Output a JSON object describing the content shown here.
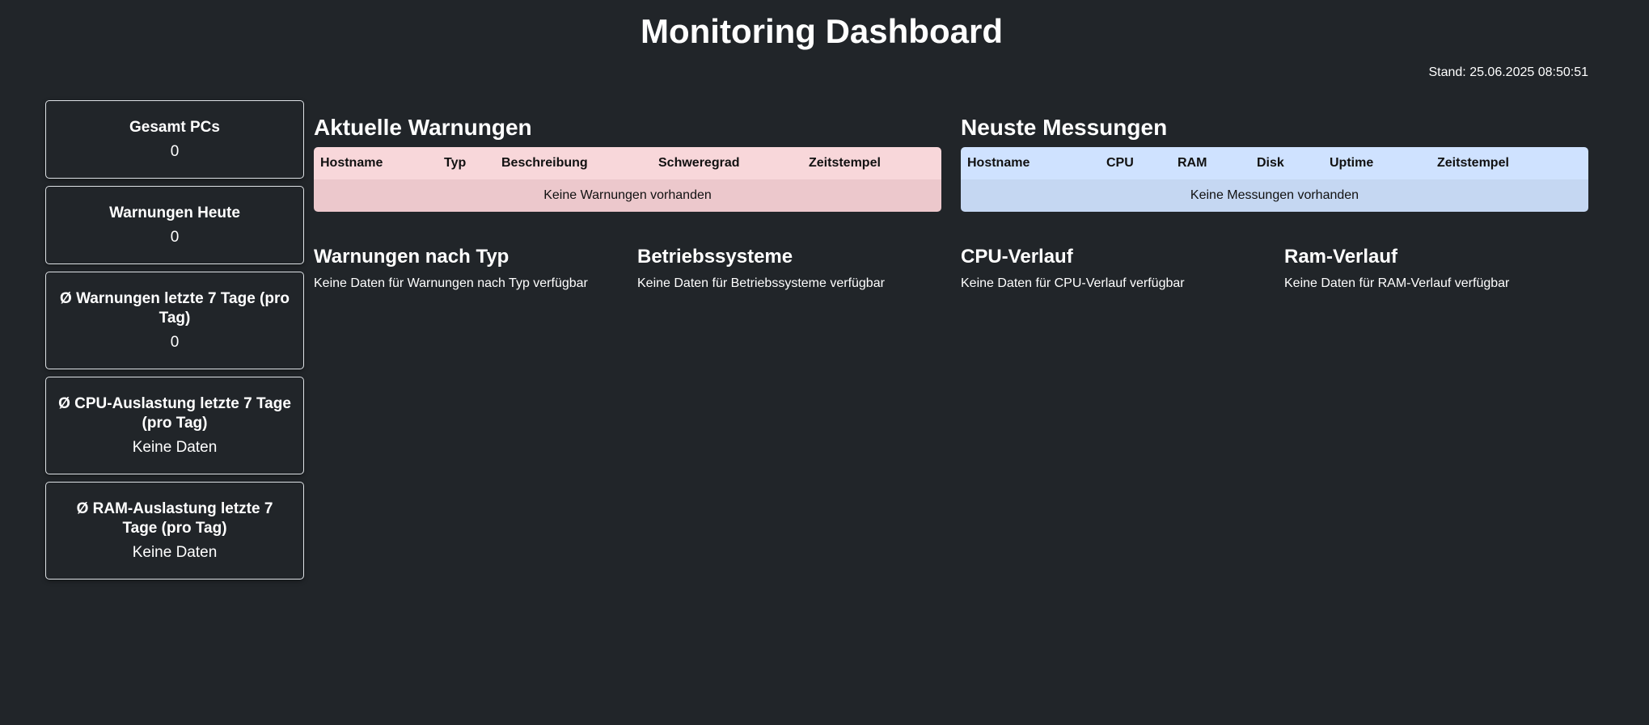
{
  "header": {
    "title": "Monitoring Dashboard",
    "stand": "Stand: 25.06.2025 08:50:51"
  },
  "stats": [
    {
      "title": "Gesamt PCs",
      "value": "0"
    },
    {
      "title": "Warnungen Heute",
      "value": "0"
    },
    {
      "title": "Ø Warnungen letzte 7 Tage (pro Tag)",
      "value": "0"
    },
    {
      "title": "Ø CPU-Auslastung letzte 7 Tage (pro Tag)",
      "value": "Keine Daten"
    },
    {
      "title": "Ø RAM-Auslastung letzte 7 Tage (pro Tag)",
      "value": "Keine Daten"
    }
  ],
  "warnings": {
    "heading": "Aktuelle Warnungen",
    "columns": [
      "Hostname",
      "Typ",
      "Beschreibung",
      "Schweregrad",
      "Zeitstempel"
    ],
    "empty": "Keine Warnungen vorhanden",
    "color": "#f8d7da"
  },
  "measurements": {
    "heading": "Neuste Messungen",
    "columns": [
      "Hostname",
      "CPU",
      "RAM",
      "Disk",
      "Uptime",
      "Zeitstempel"
    ],
    "empty": "Keine Messungen vorhanden",
    "color": "#cfe2ff"
  },
  "charts": [
    {
      "title": "Warnungen nach Typ",
      "empty": "Keine Daten für Warnungen nach Typ verfügbar"
    },
    {
      "title": "Betriebssysteme",
      "empty": "Keine Daten für Betriebssysteme verfügbar"
    },
    {
      "title": "CPU-Verlauf",
      "empty": "Keine Daten für CPU-Verlauf verfügbar"
    },
    {
      "title": "Ram-Verlauf",
      "empty": "Keine Daten für RAM-Verlauf verfügbar"
    }
  ],
  "theme": {
    "background": "#212529",
    "text": "#ffffff",
    "card_border": "#dee2e6"
  }
}
